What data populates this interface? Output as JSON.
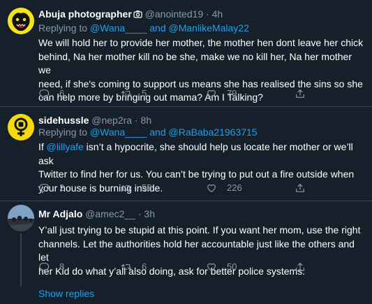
{
  "tweets": [
    {
      "name": "Abuja photographer",
      "handle": "@anointed19",
      "sep": "·",
      "time": "4h",
      "replying_label": "Replying to",
      "reply_to_1": "@Wana____",
      "reply_and": "and",
      "reply_to_2": "@ManlikeMalay22",
      "text_1": "We will hold her to provide her mother, the mother hen dont leave her chick",
      "text_2": "behind, Na her mother kill no be she, make we no kill her, Na her mother we",
      "text_3": "need, if she's coming to support us means she has realised the sins so she",
      "text_4": "can help more by bringing out mama? Am I Talking?",
      "replies": "6",
      "retweets": "5",
      "likes": "79"
    },
    {
      "name": "sidehussle",
      "handle": "@nep2ra",
      "sep": "·",
      "time": "8h",
      "replying_label": "Replying to",
      "reply_to_1": "@Wana____",
      "reply_and": "and",
      "reply_to_2": "@RaBaba21963715",
      "text_prefix": "If ",
      "text_mention": "@lillyafe",
      "text_1_rest": " isn’t a hypocrite, she should help us locate her mother or we’ll ask",
      "text_2": "Twitter to find her for us. You can’t be trying to put out a fire outside when",
      "text_3": "your house is burning inside.",
      "replies": "2",
      "retweets": "56",
      "likes": "226"
    },
    {
      "name": "Mr Adjalo",
      "handle": "@amec2__",
      "sep": "·",
      "time": "3h",
      "text_1": "Y’all just trying to be stupid at this point. If you want her mom, use the right",
      "text_2": "channels. Let the authorities hold her accountable just like the others and let",
      "text_3": "her Kid do what y’all also doing, ask for better police systems.",
      "replies": "8",
      "retweets": "6",
      "likes": "50"
    }
  ],
  "show_replies": "Show replies",
  "icons": {
    "reply": "reply-icon",
    "retweet": "retweet-icon",
    "like": "heart-icon",
    "share": "share-icon",
    "camera": "camera-icon"
  },
  "colors": {
    "background": "#15202b",
    "secondary_text": "#8899a6",
    "accent": "#1da1f2",
    "divider": "#38444d"
  }
}
